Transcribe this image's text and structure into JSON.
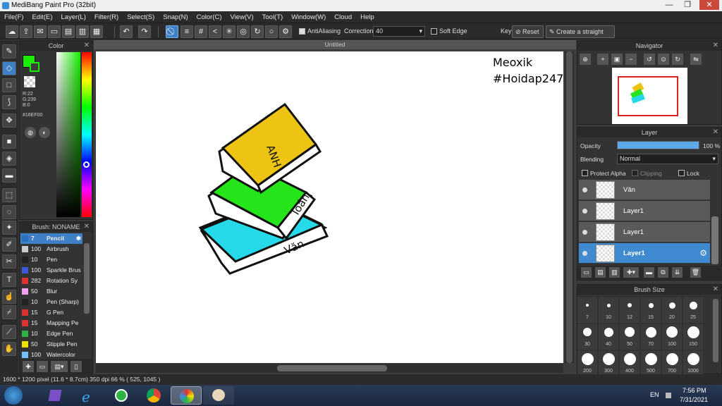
{
  "window": {
    "title": "MediBang Paint Pro (32bit)",
    "minimize": "—",
    "restore": "❐",
    "close": "✕"
  },
  "menu": [
    "File(F)",
    "Edit(E)",
    "Layer(L)",
    "Filter(R)",
    "Select(S)",
    "Snap(N)",
    "Color(C)",
    "View(V)",
    "Tool(T)",
    "Window(W)",
    "Cloud",
    "Help"
  ],
  "toolbar": {
    "antialiasing_label": "AntiAliasing",
    "correction_label": "Correction",
    "correction_value": "40",
    "soft_edge_label": "Soft Edge",
    "key_label": "Key",
    "reset_label": "Reset",
    "straight_line_label": "Create a straight line"
  },
  "color_panel": {
    "title": "Color",
    "r": "R:22",
    "g": "G:239",
    "b": "B:0",
    "hex": "#16EF00",
    "foreground": "#16EF00",
    "background": "#ff0000"
  },
  "brush_panel": {
    "title": "Brush: NONAME",
    "brushes": [
      {
        "size": "7",
        "name": "Pencil",
        "color": "#2b6fc0",
        "selected": true
      },
      {
        "size": "100",
        "name": "Airbrush",
        "color": "#cccccc"
      },
      {
        "size": "10",
        "name": "Pen",
        "color": "#222222"
      },
      {
        "size": "100",
        "name": "Sparkle Brus",
        "color": "#3b5bdb"
      },
      {
        "size": "282",
        "name": "Rotation Sy",
        "color": "#e03131"
      },
      {
        "size": "50",
        "name": "Blur",
        "color": "#f3a0f0"
      },
      {
        "size": "10",
        "name": "Pen (Sharp)",
        "color": "#222222"
      },
      {
        "size": "15",
        "name": "G Pen",
        "color": "#e03131"
      },
      {
        "size": "15",
        "name": "Mapping Pe",
        "color": "#e03131"
      },
      {
        "size": "10",
        "name": "Edge Pen",
        "color": "#2fb344"
      },
      {
        "size": "50",
        "name": "Stipple Pen",
        "color": "#f0e000"
      },
      {
        "size": "100",
        "name": "Watercolor",
        "color": "#74c0fc"
      }
    ]
  },
  "canvas": {
    "title": "Untitled",
    "text_line1": "Meoxik",
    "text_line2": "#Hoidap247",
    "book_labels": [
      "ANH",
      "Toán",
      "Văn"
    ]
  },
  "navigator": {
    "title": "Navigator"
  },
  "layer_panel": {
    "title": "Layer",
    "opacity_label": "Opacity",
    "opacity_value": "100 %",
    "opacity_fraction": 1.0,
    "blending_label": "Blending",
    "blending_value": "Normal",
    "protect_alpha": "Protect Alpha",
    "clipping": "Clipping",
    "lock": "Lock",
    "layers": [
      {
        "name": "Văn",
        "selected": false
      },
      {
        "name": "Layer1",
        "selected": false
      },
      {
        "name": "Layer1",
        "selected": false
      },
      {
        "name": "Layer1",
        "selected": true
      }
    ]
  },
  "brush_size_panel": {
    "title": "Brush Size",
    "sizes": [
      "7",
      "10",
      "12",
      "15",
      "20",
      "25",
      "30",
      "40",
      "50",
      "70",
      "100",
      "150",
      "200",
      "300",
      "400",
      "500",
      "700",
      "1000"
    ]
  },
  "status": {
    "text": "1600 * 1200 pixel  (11.6 * 8.7cm)  350 dpi  66 %  ( 525, 1045 )"
  },
  "taskbar": {
    "lang": "EN",
    "time": "7:56 PM",
    "date": "7/31/2021"
  }
}
